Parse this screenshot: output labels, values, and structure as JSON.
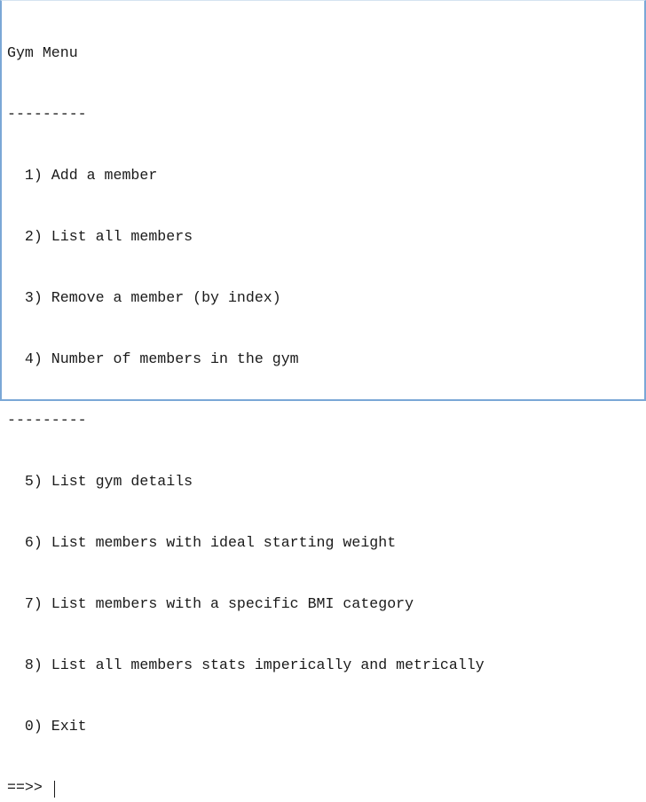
{
  "console": {
    "title": "Gym Menu",
    "separator": "---------",
    "section1": [
      "  1) Add a member",
      "  2) List all members",
      "  3) Remove a member (by index)",
      "  4) Number of members in the gym"
    ],
    "separator2": "---------",
    "section2": [
      "  5) List gym details",
      "  6) List members with ideal starting weight",
      "  7) List members with a specific BMI category",
      "  8) List all members stats imperically and metrically",
      "  0) Exit"
    ],
    "prompt": "==>> "
  }
}
